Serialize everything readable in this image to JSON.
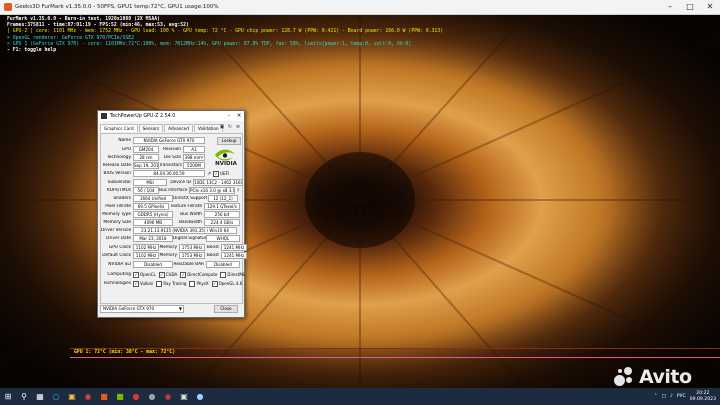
{
  "colors": {
    "bg_orange": "#c9771c",
    "bg_dark": "#2a1206",
    "overlay_yellow": "#f5e400",
    "overlay_cyan": "#34d9ff",
    "nvidia_green": "#76b900",
    "taskbar": "#1c2b3f"
  },
  "furmark": {
    "window_title": "Geeks3D FurMark v1.35.0.0 - 50FPS, GPU1 temp:72°C, GPU1 usage:100%",
    "overlay_lines": [
      {
        "text": "FurMark v1.35.0.0 - Burn-in test, 1920x1080 (2X MSAA)",
        "cls": "c-white"
      },
      {
        "text": "Frames:375811 - time:07:01:19 - FPS:52 (min:46, max:53, avg:52)",
        "cls": "c-white"
      },
      {
        "text": "[ GPU-Z ] core: 1101 MHz - mem: 1752 MHz - GPU load: 100 % - GPU temp: 72 °C - GPU chip power: 128.7 W (PPW: 0.421) - Board power: 166.0 W (PPW: 0.313)",
        "cls": "c-yellow"
      },
      {
        "text": "> OpenGL renderer: GeForce GTX 970/PCIe/SSE2",
        "cls": "c-cyan"
      },
      {
        "text": "> GPU 1 (GeForce GTX 970) - core: 1101MHz:72°C:100%, mem: 7012MHz:14%, GPU power: 87.8% TDP, fan: 58%, limits[power:1, temp:0, volt:0, OV:0]",
        "cls": "c-teal"
      },
      {
        "text": "- F1: toggle help",
        "cls": "c-white"
      }
    ],
    "temp_graph_label": "GPU 1: 72°C (min: 38°C - max: 72°C)"
  },
  "gpuz": {
    "title": "TechPowerUp GPU-Z 2.54.0",
    "tabs": [
      "Graphics Card",
      "Sensors",
      "Advanced",
      "Validation"
    ],
    "active_tab": 0,
    "name_label": "Name",
    "name_value": "NVIDIA GeForce GTX 970",
    "lookup_button": "Lookup",
    "gpu_label": "GPU",
    "gpu_value": "GM204",
    "revision_label": "Revision",
    "revision_value": "A1",
    "technology_label": "Technology",
    "technology_value": "28 nm",
    "diesize_label": "Die Size",
    "diesize_value": "398 mm²",
    "release_label": "Release Date",
    "release_value": "Sep 19, 2014",
    "transistors_label": "Transistors",
    "transistors_value": "5200M",
    "bios_label": "BIOS Version",
    "bios_value": "84.04.36.00.59",
    "uefi_label": "UEFI",
    "subvendor_label": "Subvendor",
    "subvendor_value": "MSI",
    "deviceid_label": "Device ID",
    "deviceid_value": "10DE 13C2 - 1462 3160",
    "rops_label": "ROPs/TMUs",
    "rops_value": "56 / 104",
    "businterface_label": "Bus Interface",
    "businterface_value": "PCIe x16 3.0 @ x8 3.0",
    "shaders_label": "Shaders",
    "shaders_value": "1664 Unified",
    "directx_label": "DirectX Support",
    "directx_value": "12 (12_1)",
    "pixelfill_label": "Pixel Fillrate",
    "pixelfill_value": "69.5 GPixel/s",
    "texturefill_label": "Texture Fillrate",
    "texturefill_value": "129.1 GTexel/s",
    "memtype_label": "Memory Type",
    "memtype_value": "GDDR5 (Hynix)",
    "buswidth_label": "Bus Width",
    "buswidth_value": "256 bit",
    "memsize_label": "Memory Size",
    "memsize_value": "4096 MB",
    "bandwidth_label": "Bandwidth",
    "bandwidth_value": "224.4 GB/s",
    "driverver_label": "Driver Version",
    "driverver_value": "23.21.13.9135 (NVIDIA 391.35) / Win10 64",
    "driverdate_label": "Driver Date",
    "driverdate_value": "Mar 23, 2018",
    "digsig_label": "Digital Signature",
    "digsig_value": "WHQL",
    "gpuclock_label": "GPU Clock",
    "gpuclock_value": "1102 MHz",
    "memory_label": "Memory",
    "memory_value": "1753 MHz",
    "boost_label": "Boost",
    "boost_value": "1241 MHz",
    "defclock_label": "Default Clock",
    "defclock_value": "1102 MHz",
    "defmemory_value": "1753 MHz",
    "defboost_value": "1241 MHz",
    "sli_label": "NVIDIA SLI",
    "sli_value": "Disabled",
    "rebar_label": "Resizable BAR",
    "rebar_value": "Disabled",
    "computing_label": "Computing",
    "computing_items": [
      "OpenCL",
      "CUDA",
      "DirectCompute",
      "DirectML"
    ],
    "technologies_label": "Technologies",
    "technologies_items": [
      "Vulkan",
      "Ray Tracing",
      "PhysX",
      "OpenGL 4.6"
    ],
    "bottom_select": "NVIDIA GeForce GTX 970",
    "close_button": "Close",
    "nvidia_text": "NVIDIA"
  },
  "avito": {
    "word": "Avito"
  },
  "taskbar": {
    "lang": "РУС",
    "time": "20:22",
    "date": "09.09.2023"
  }
}
